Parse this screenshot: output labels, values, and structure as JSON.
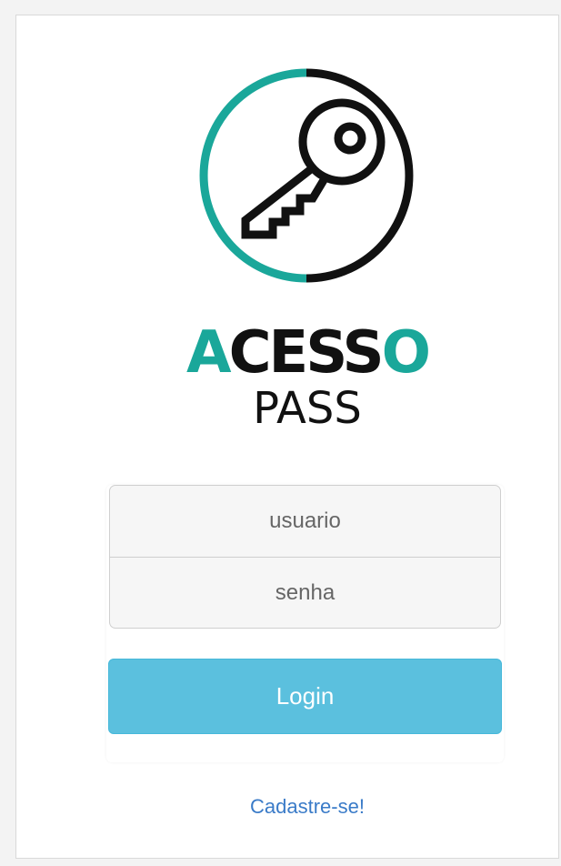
{
  "brand": {
    "logo_icon": "key-icon",
    "word_main_accent": "A",
    "word_main_rest": "CESS",
    "word_main_end": "O",
    "word_sub": "PASS",
    "accent_color": "#1aa79a"
  },
  "form": {
    "username_placeholder": "usuario",
    "password_placeholder": "senha",
    "login_label": "Login",
    "login_color": "#5bc0de"
  },
  "links": {
    "signup": "Cadastre-se!"
  }
}
